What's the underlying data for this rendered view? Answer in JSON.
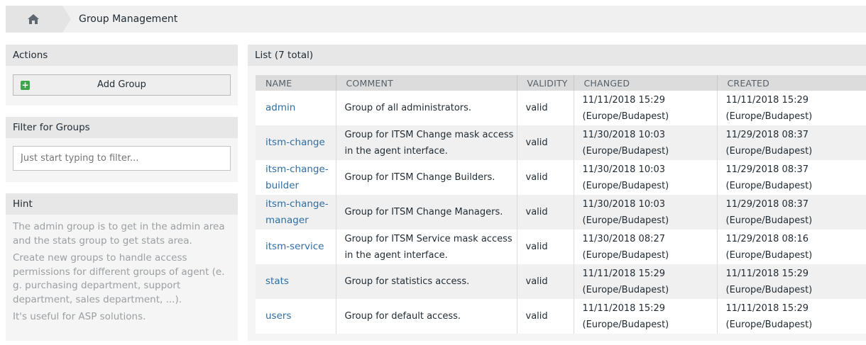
{
  "breadcrumb": {
    "home_icon": "home-icon",
    "title": "Group Management"
  },
  "actions": {
    "header": "Actions",
    "add_group_label": "Add Group",
    "add_icon": "plus-icon"
  },
  "filter": {
    "header": "Filter for Groups",
    "placeholder": "Just start typing to filter..."
  },
  "hint": {
    "header": "Hint",
    "paragraphs": [
      "The admin group is to get in the admin area and the stats group to get stats area.",
      "Create new groups to handle access permissions for different groups of agent (e. g. purchasing department, support department, sales department, ...).",
      "It's useful for ASP solutions."
    ]
  },
  "list": {
    "header": "List (7 total)",
    "columns": [
      "NAME",
      "COMMENT",
      "VALIDITY",
      "CHANGED",
      "CREATED"
    ],
    "rows": [
      {
        "name": "admin",
        "comment": "Group of all administrators.",
        "validity": "valid",
        "changed": "11/11/2018 15:29",
        "changed_tz": "(Europe/Budapest)",
        "created": "11/11/2018 15:29",
        "created_tz": "(Europe/Budapest)"
      },
      {
        "name": "itsm-change",
        "comment": "Group for ITSM Change mask access in the agent interface.",
        "validity": "valid",
        "changed": "11/30/2018 10:03",
        "changed_tz": "(Europe/Budapest)",
        "created": "11/29/2018 08:37",
        "created_tz": "(Europe/Budapest)"
      },
      {
        "name": "itsm-change-builder",
        "comment": "Group for ITSM Change Builders.",
        "validity": "valid",
        "changed": "11/30/2018 10:03",
        "changed_tz": "(Europe/Budapest)",
        "created": "11/29/2018 08:37",
        "created_tz": "(Europe/Budapest)"
      },
      {
        "name": "itsm-change-manager",
        "comment": "Group for ITSM Change Managers.",
        "validity": "valid",
        "changed": "11/30/2018 10:03",
        "changed_tz": "(Europe/Budapest)",
        "created": "11/29/2018 08:37",
        "created_tz": "(Europe/Budapest)"
      },
      {
        "name": "itsm-service",
        "comment": "Group for ITSM Service mask access in the agent interface.",
        "validity": "valid",
        "changed": "11/30/2018 08:27",
        "changed_tz": "(Europe/Budapest)",
        "created": "11/29/2018 08:16",
        "created_tz": "(Europe/Budapest)"
      },
      {
        "name": "stats",
        "comment": "Group for statistics access.",
        "validity": "valid",
        "changed": "11/11/2018 15:29",
        "changed_tz": "(Europe/Budapest)",
        "created": "11/11/2018 15:29",
        "created_tz": "(Europe/Budapest)"
      },
      {
        "name": "users",
        "comment": "Group for default access.",
        "validity": "valid",
        "changed": "11/11/2018 15:29",
        "changed_tz": "(Europe/Budapest)",
        "created": "11/11/2018 15:29",
        "created_tz": "(Europe/Budapest)"
      }
    ]
  }
}
